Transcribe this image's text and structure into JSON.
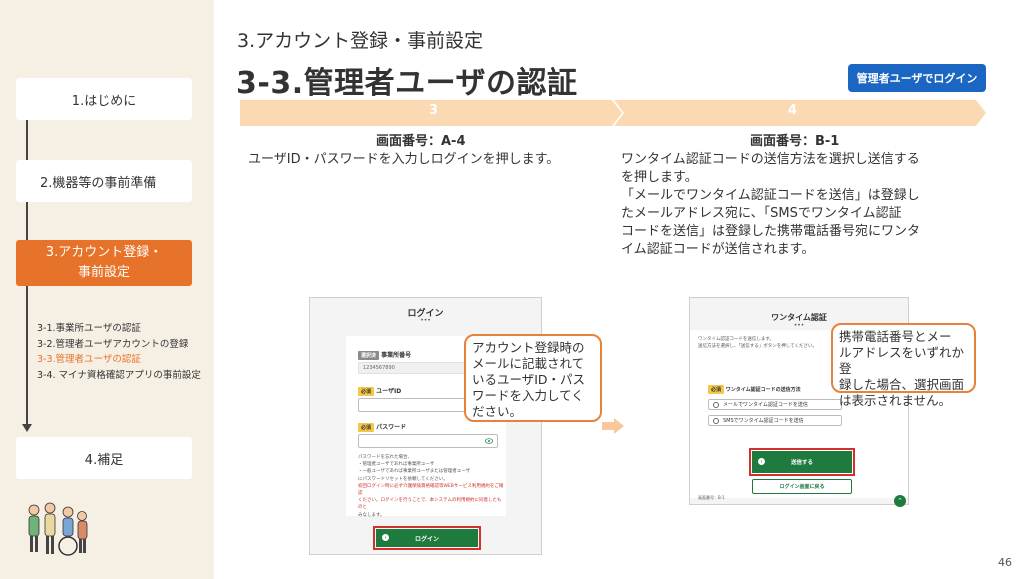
{
  "sidebar": {
    "nav": [
      {
        "label": "1.はじめに"
      },
      {
        "label": "2.機器等の事前準備"
      },
      {
        "label_line1": "3.アカウント登録・",
        "label_line2": "事前設定"
      },
      {
        "label": "4.補足"
      }
    ],
    "subnav": [
      "3-1.事業所ユーザの認証",
      "3-2.管理者ユーザアカウントの登録",
      "3-3.管理者ユーザの認証",
      "3-4. マイナ資格確認アプリの事前設定"
    ]
  },
  "header": {
    "kicker": "3.アカウント登録・事前設定",
    "title": "3-3.管理者ユーザの認証",
    "badge": "管理者ユーザでログイン"
  },
  "steps": [
    {
      "num": "3",
      "screen_no": "画面番号：A-4",
      "desc": [
        "ユーザID・パスワードを入力しログインを押します。"
      ]
    },
    {
      "num": "4",
      "screen_no": "画面番号：B-1",
      "desc": [
        "ワンタイム認証コードの送信方法を選択し送信する",
        "を押します。",
        "「メールでワンタイム認証コードを送信」は登録し",
        "たメールアドレス宛に、「SMSでワンタイム認証",
        "コードを送信」は登録した携帯電話番号宛にワンタ",
        "イム認証コードが送信されます。"
      ]
    }
  ],
  "login_screen": {
    "title": "ログイン",
    "dots": "•••",
    "office_tag": "選択済",
    "office_label": "事業所番号",
    "office_value": "1234567890",
    "required_tag": "必須",
    "userid_label": "ユーザID",
    "password_label": "パスワード",
    "notes": [
      "パスワードを忘れた場合、",
      "・管理者ユーザであれば事業所ユーザ",
      "・一般ユーザであれば事業所ユーザまたは管理者ユーザ",
      "にパスワードリセットを依頼してください。",
      "初回ログイン時に必ず介護保険資格確認等WEBサービス利用規約をご確認",
      "ください。ログインを行うことで、本システムの利用規約に同意したものと",
      "みなします。"
    ],
    "login_button": "ログイン"
  },
  "callouts": {
    "login": [
      "アカウント登録時の",
      "メールに記載されて",
      "いるユーザID・パス",
      "ワードを入力してく",
      "ださい。"
    ],
    "otp": [
      "携帯電話番号とメー",
      "ルアドレスをいずれか登",
      "録した場合、選択画面",
      "は表示されません。"
    ]
  },
  "otp_screen": {
    "title": "ワンタイム認証",
    "dots": "•••",
    "intro": [
      "ワンタイム認証コードを送信します。",
      "送信方法を選択し、「送信する」ボタンを押してください。"
    ],
    "required_tag": "必須",
    "method_label": "ワンタイム認証コードの送信方法",
    "option_email": "メールでワンタイム認証コードを送信",
    "option_sms": "SMSでワンタイム認証コードを送信",
    "send_button": "送信する",
    "back_button": "ログイン画面に戻る",
    "footer_id": "画面番号：B-1"
  },
  "page_number": "46",
  "colors": {
    "accent_orange": "#e7732a",
    "badge_blue": "#1a66c2",
    "button_green": "#1f7a3e",
    "highlight_red": "#d2302c",
    "stepbar_peach": "#fbd9b3"
  }
}
